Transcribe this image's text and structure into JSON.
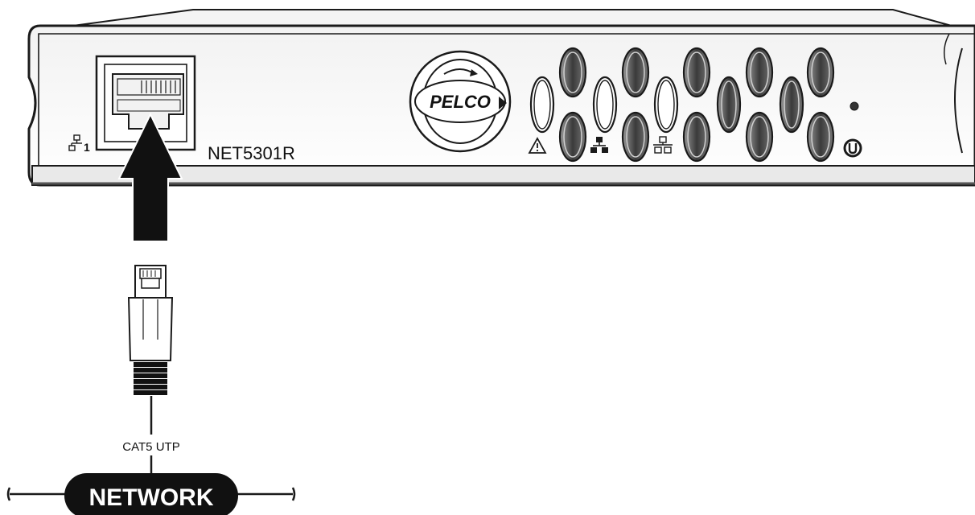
{
  "device": {
    "model_label": "NET5301R",
    "brand_logo_text": "PELCO",
    "port_number": "1"
  },
  "cable": {
    "label": "CAT5 UTP"
  },
  "network": {
    "label": "NETWORK"
  },
  "icons": {
    "port_icon": "network-port-icon",
    "warning_icon": "warning-icon",
    "link_icon": "network-link-icon",
    "activity_icon": "network-activity-icon",
    "power_icon": "power-icon",
    "arrow": "connect-arrow-up"
  },
  "colors": {
    "line": "#1a1a1a",
    "panel": "#ffffff",
    "panel_shade": "#e6e6e6",
    "vent": "#3a3a3a",
    "network_fill": "#111111",
    "network_text": "#ffffff"
  }
}
